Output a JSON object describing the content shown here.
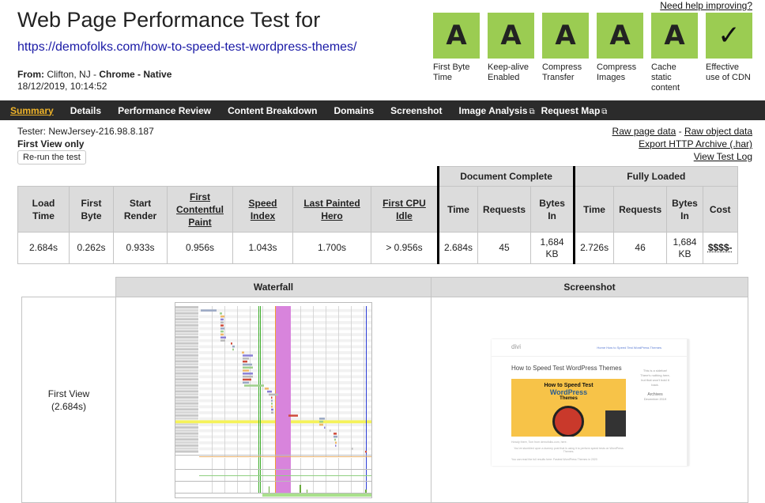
{
  "header": {
    "title": "Web Page Performance Test for",
    "url": "https://demofolks.com/how-to-speed-test-wordpress-themes/",
    "from_label": "From:",
    "from_location": "Clifton, NJ",
    "from_sep1": " - ",
    "browser": "Chrome",
    "from_sep2": " - ",
    "connection": "Native",
    "datetime": "18/12/2019, 10:14:52",
    "help_link": "Need help improving?"
  },
  "grades": [
    {
      "grade": "A",
      "label": "First Byte Time",
      "color": "#9bcc52"
    },
    {
      "grade": "A",
      "label": "Keep-alive Enabled",
      "color": "#9bcc52"
    },
    {
      "grade": "A",
      "label": "Compress Transfer",
      "color": "#9bcc52"
    },
    {
      "grade": "A",
      "label": "Compress Images",
      "color": "#9bcc52"
    },
    {
      "grade": "A",
      "label": "Cache static content",
      "color": "#9bcc52"
    },
    {
      "grade": "✓",
      "label": "Effective use of CDN",
      "color": "#9bcc52"
    }
  ],
  "nav": {
    "items": [
      {
        "label": "Summary",
        "active": true
      },
      {
        "label": "Details"
      },
      {
        "label": "Performance Review"
      },
      {
        "label": "Content Breakdown"
      },
      {
        "label": "Domains"
      },
      {
        "label": "Screenshot"
      },
      {
        "label": "Image Analysis",
        "external_icon": "external-link-icon"
      },
      {
        "label": "Request Map",
        "external_icon": "external-link-icon"
      }
    ],
    "active_color": "#f0b429"
  },
  "test_info": {
    "tester": "Tester: NewJersey-216.98.8.187",
    "view_mode": "First View only",
    "rerun_button": "Re-run the test",
    "raw_page_data": "Raw page data",
    "links_sep": " - ",
    "raw_object_data": "Raw object data",
    "export_har": "Export HTTP Archive (.har)",
    "view_test_log": "View Test Log"
  },
  "metrics": {
    "group_headers": {
      "document_complete": "Document Complete",
      "fully_loaded": "Fully Loaded"
    },
    "headers": {
      "load_time": "Load Time",
      "first_byte": "First Byte",
      "start_render": "Start Render",
      "fcp": "First Contentful Paint",
      "speed_index": "Speed Index",
      "last_painted_hero": "Last Painted Hero",
      "first_cpu_idle": "First CPU Idle",
      "dc_time": "Time",
      "dc_requests": "Requests",
      "dc_bytes": "Bytes In",
      "fl_time": "Time",
      "fl_requests": "Requests",
      "fl_bytes": "Bytes In",
      "cost": "Cost"
    },
    "values": {
      "load_time": "2.684s",
      "first_byte": "0.262s",
      "start_render": "0.933s",
      "fcp": "0.956s",
      "speed_index": "1.043s",
      "last_painted_hero": "1.700s",
      "first_cpu_idle": "> 0.956s",
      "dc_time": "2.684s",
      "dc_requests": "45",
      "dc_bytes_num": "1,684",
      "dc_bytes_unit": "KB",
      "fl_time": "2.726s",
      "fl_requests": "46",
      "fl_bytes_num": "1,684",
      "fl_bytes_unit": "KB",
      "cost": "$$$$-"
    }
  },
  "results": {
    "waterfall_header": "Waterfall",
    "screenshot_header": "Screenshot",
    "row_label": "First View",
    "row_time": "(2.684s)",
    "screenshot": {
      "logo": "divi",
      "menu": "Home   How to Speed Test WordPress Themes",
      "post_title": "How to Speed Test WordPress Themes",
      "hero_line1": "How to Speed Test",
      "hero_line2": "WordPress",
      "hero_line3": "Themes",
      "sidebar_title": "This is a sidebar!",
      "sidebar_text": "There's nothing here, but that won't hold it back.",
      "archives": "Archives",
      "archive_item": "December 2019",
      "p1": "Howdy there, Tom from demofolks.com, here.",
      "p2": "You've stumbled upon a dummy post that is using it to perform speed tests on WordPress Themes.",
      "p3": "You can read the full results here: Fastest WordPress Themes in 2020"
    },
    "waterfall": {
      "markers_color": {
        "start_render": "#3cab2a",
        "dom_loaded": "#f0a030",
        "onload": "#2a3bd6",
        "long_task": "#d884dc",
        "highlight": "#f5f25a"
      }
    }
  }
}
